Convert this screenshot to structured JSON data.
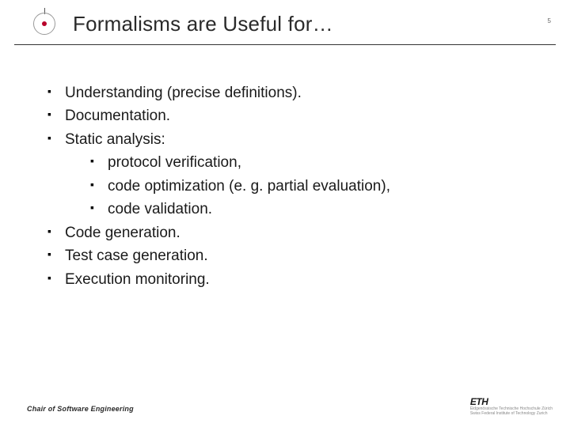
{
  "header": {
    "title": "Formalisms are Useful for…",
    "page_number": "5"
  },
  "bullets": {
    "b0": "Understanding (precise definitions).",
    "b1": "Documentation.",
    "b2": "Static analysis:",
    "b2_sub0": "protocol verification,",
    "b2_sub1": "code optimization (e. g. partial evaluation),",
    "b2_sub2": "code validation.",
    "b3": "Code generation.",
    "b4": "Test case generation.",
    "b5": "Execution monitoring."
  },
  "footer": {
    "chair": "Chair of Software Engineering",
    "eth": "ETH",
    "eth_sub1": "Eidgenössische Technische Hochschule Zürich",
    "eth_sub2": "Swiss Federal Institute of Technology Zurich"
  }
}
